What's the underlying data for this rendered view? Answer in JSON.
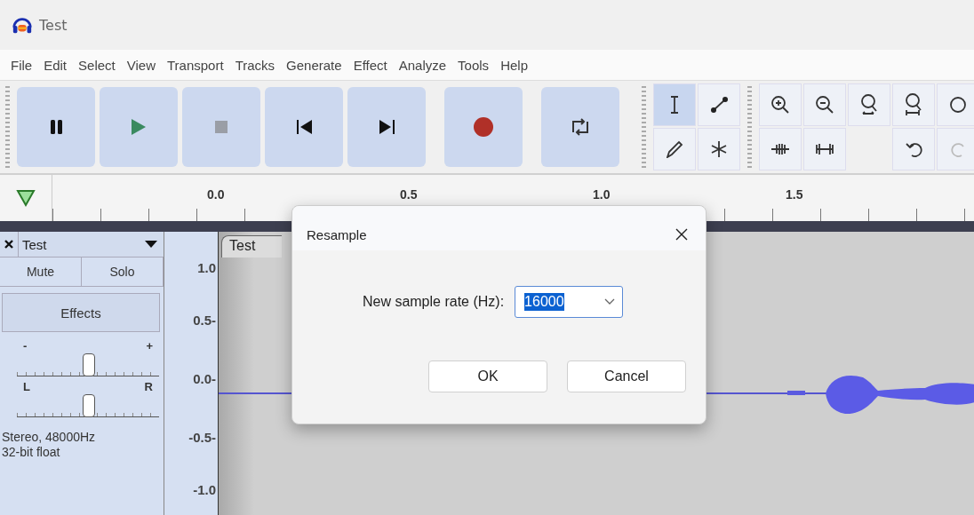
{
  "window": {
    "title": "Test"
  },
  "menu": [
    "File",
    "Edit",
    "Select",
    "View",
    "Transport",
    "Tracks",
    "Generate",
    "Effect",
    "Analyze",
    "Tools",
    "Help"
  ],
  "transport": [
    {
      "kind": "pause"
    },
    {
      "kind": "play"
    },
    {
      "kind": "stop"
    },
    {
      "kind": "skip-start"
    },
    {
      "kind": "skip-end"
    },
    {
      "kind": "record"
    },
    {
      "kind": "loop"
    }
  ],
  "tools": [
    {
      "kind": "select",
      "selected": true
    },
    {
      "kind": "envelope",
      "selected": false
    },
    {
      "kind": "draw",
      "selected": false
    },
    {
      "kind": "multi",
      "selected": false
    }
  ],
  "edit_tools": [
    {
      "kind": "zoom-in"
    },
    {
      "kind": "zoom-out"
    },
    {
      "kind": "fit-selection"
    },
    {
      "kind": "fit-project"
    },
    {
      "kind": "zoom-toggle"
    },
    {
      "kind": "trim"
    },
    {
      "kind": "silence"
    },
    {
      "kind": "blank"
    },
    {
      "kind": "undo"
    },
    {
      "kind": "redo"
    }
  ],
  "ruler": {
    "labels": [
      "0.0",
      "0.5",
      "1.0",
      "1.5"
    ]
  },
  "track": {
    "name": "Test",
    "buttons": [
      "Mute",
      "Solo"
    ],
    "effects": "Effects",
    "gain": {
      "min_label": "-",
      "max_label": "+",
      "level": 0.5
    },
    "pan": {
      "min_label": "L",
      "max_label": "R",
      "level": 0.5
    },
    "info": [
      "Stereo, 48000Hz",
      "32-bit float"
    ],
    "scale": [
      "1.0",
      "0.5-",
      "0.0-",
      "-0.5-",
      "-1.0"
    ],
    "clip_name": "Test"
  },
  "dialog": {
    "title": "Resample",
    "label": "New sample rate (Hz):",
    "value": "16000",
    "buttons": [
      "OK",
      "Cancel"
    ]
  }
}
